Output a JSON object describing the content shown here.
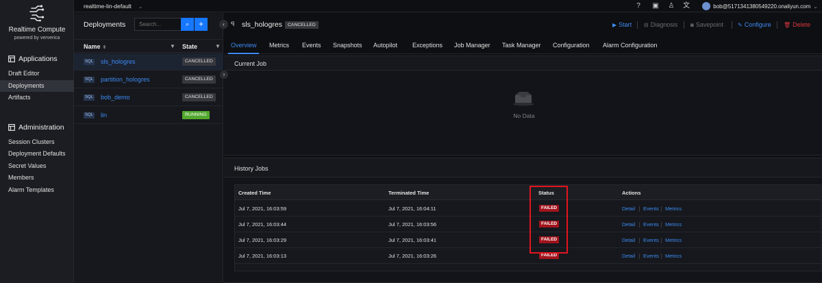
{
  "colors": {
    "accent": "#1677ff",
    "link": "#3d8bf3",
    "danger": "#d9363e",
    "failed": "#a1141d",
    "running": "#52a82e",
    "highlight": "#e5141f"
  },
  "brand": {
    "title": "Realtime Compute",
    "subtitle": "powered by ververica"
  },
  "sidebar": {
    "applications_label": "Applications",
    "applications": [
      {
        "label": "Draft Editor"
      },
      {
        "label": "Deployments"
      },
      {
        "label": "Artifacts"
      }
    ],
    "administration_label": "Administration",
    "administration": [
      {
        "label": "Session Clusters"
      },
      {
        "label": "Deployment Defaults"
      },
      {
        "label": "Secret Values"
      },
      {
        "label": "Members"
      },
      {
        "label": "Alarm Templates"
      }
    ]
  },
  "topbar": {
    "namespace": "realtime-lin-default",
    "icons": [
      "help-icon",
      "notification-icon",
      "shirt-icon",
      "translate-icon"
    ],
    "user": "bob@5171341380549220.onaliyun.com"
  },
  "deployments": {
    "title": "Deployments",
    "search_placeholder": "Search...",
    "col_name": "Name",
    "col_state": "State",
    "sql_tag": "SQL",
    "rows": [
      {
        "name": "sls_hologres",
        "state": "CANCELLED"
      },
      {
        "name": "partition_hologres",
        "state": "CANCELLED"
      },
      {
        "name": "bob_demo",
        "state": "CANCELLED"
      },
      {
        "name": "lin",
        "state": "RUNNING"
      }
    ]
  },
  "job": {
    "name": "sls_hologres",
    "state": "CANCELLED",
    "actions": {
      "start": "Start",
      "diagnosis": "Diagnosis",
      "savepoint": "Savepoint",
      "configure": "Configure",
      "delete": "Delete"
    }
  },
  "tabs": [
    {
      "label": "Overview"
    },
    {
      "label": "Metrics"
    },
    {
      "label": "Events"
    },
    {
      "label": "Snapshots"
    },
    {
      "label": "Autopilot"
    },
    {
      "label": "Exceptions"
    },
    {
      "label": "Job Manager"
    },
    {
      "label": "Task Manager"
    },
    {
      "label": "Configuration"
    },
    {
      "label": "Alarm Configuration"
    }
  ],
  "current_job": {
    "title": "Current Job",
    "empty_text": "No Data"
  },
  "history": {
    "title": "History Jobs",
    "columns": {
      "created": "Created Time",
      "terminated": "Terminated Time",
      "status": "Status",
      "actions": "Actions"
    },
    "action_labels": {
      "detail": "Detail",
      "events": "Events",
      "metrics": "Metrics"
    },
    "rows": [
      {
        "created": "Jul 7, 2021, 16:03:59",
        "terminated": "Jul 7, 2021, 16:04:11",
        "status": "FAILED"
      },
      {
        "created": "Jul 7, 2021, 16:03:44",
        "terminated": "Jul 7, 2021, 16:03:56",
        "status": "FAILED"
      },
      {
        "created": "Jul 7, 2021, 16:03:29",
        "terminated": "Jul 7, 2021, 16:03:41",
        "status": "FAILED"
      },
      {
        "created": "Jul 7, 2021, 16:03:13",
        "terminated": "Jul 7, 2021, 16:03:26",
        "status": "FAILED"
      }
    ]
  }
}
